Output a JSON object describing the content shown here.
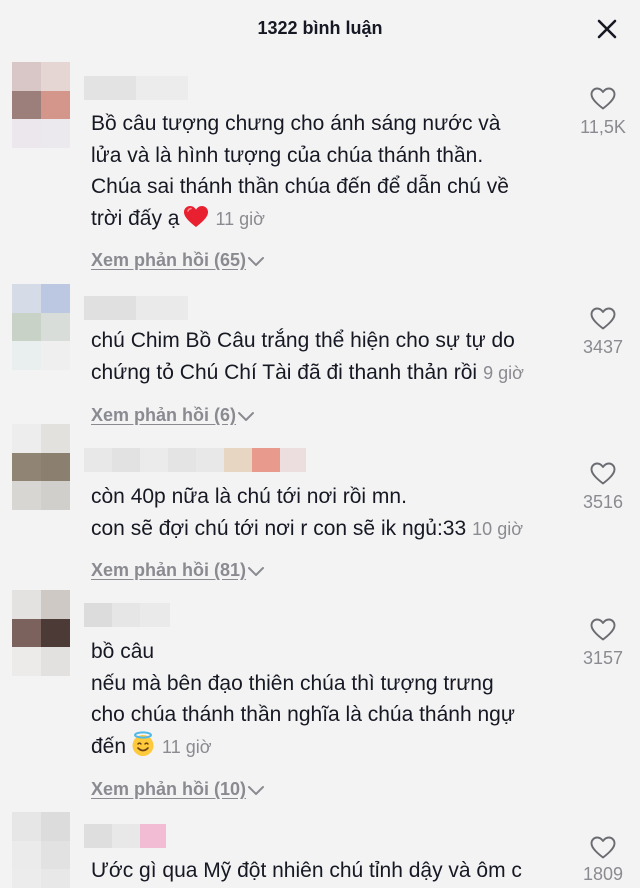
{
  "header": {
    "title": "1322 bình luận",
    "close_icon": "close-icon"
  },
  "comments": [
    {
      "lines": [
        "Bồ câu tượng chưng cho ánh sáng nước và",
        "lửa và là hình tượng của chúa thánh thần.",
        "Chúa sai thánh thần chúa đến để dẫn chú về",
        "trời đấy ạ"
      ],
      "emoji": "heart-emoji",
      "time": "11 giờ",
      "replies": "Xem phản hồi (65)",
      "likes": "11,5K"
    },
    {
      "lines": [
        "chú Chim Bồ Câu trắng thể hiện cho sự tự do",
        "chứng tỏ Chú Chí Tài đã đi thanh thản rồi"
      ],
      "time": "9 giờ",
      "replies": "Xem phản hồi (6)",
      "likes": "3437"
    },
    {
      "lines": [
        "còn 40p nữa là chú tới nơi rồi mn.",
        "con sẽ đợi chú tới nơi r con sẽ ik ngủ:33"
      ],
      "time": "10 giờ",
      "replies": "Xem phản hồi (81)",
      "likes": "3516"
    },
    {
      "lines": [
        "bồ câu",
        "nếu mà bên đạo thiên chúa thì tượng trưng",
        "cho chúa thánh thần nghĩa là chúa thánh ngự",
        "đến"
      ],
      "emoji": "halo-smile-emoji",
      "time": "11 giờ",
      "replies": "Xem phản hồi (10)",
      "likes": "3157"
    },
    {
      "lines": [
        "Ước gì qua Mỹ đột nhiên chú tỉnh dậy và ôm c"
      ],
      "likes": "1809"
    }
  ],
  "colors": {
    "text": "#161823",
    "muted": "#8a8b91",
    "background": "#f3f3f3",
    "heart": "#e8202f"
  },
  "icons": {
    "like": "heart-outline-icon",
    "expand": "chevron-down-icon"
  }
}
